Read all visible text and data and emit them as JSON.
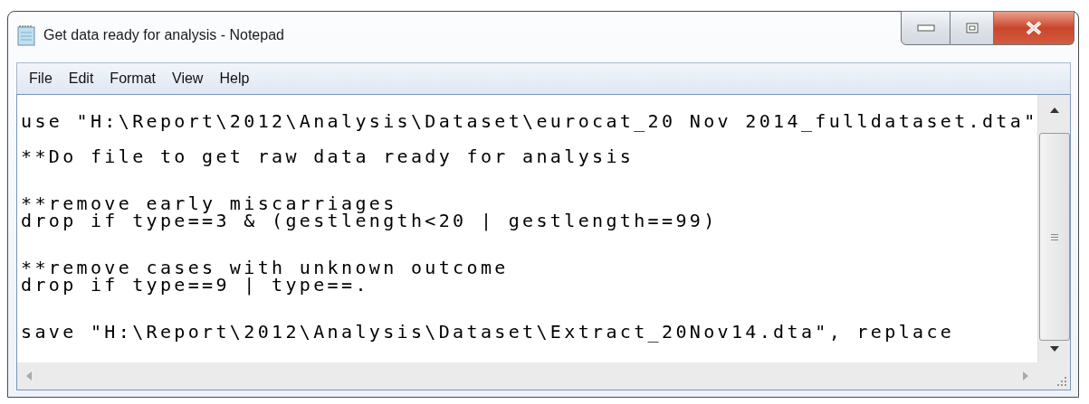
{
  "window": {
    "title": "Get data ready for analysis - Notepad"
  },
  "menu": [
    "File",
    "Edit",
    "Format",
    "View",
    "Help"
  ],
  "editor": {
    "paragraphs": [
      [
        "use \"H:\\Report\\2012\\Analysis\\Dataset\\eurocat_20 Nov 2014_fulldataset.dta\""
      ],
      [
        "**Do file to get raw data ready for analysis"
      ],
      [
        "**remove early miscarriages",
        "drop if type==3 & (gestlength<20 | gestlength==99)"
      ],
      [
        "**remove cases with unknown outcome",
        "drop if type==9 | type==."
      ],
      [
        "save \"H:\\Report\\2012\\Analysis\\Dataset\\Extract_20Nov14.dta\", replace"
      ]
    ]
  }
}
